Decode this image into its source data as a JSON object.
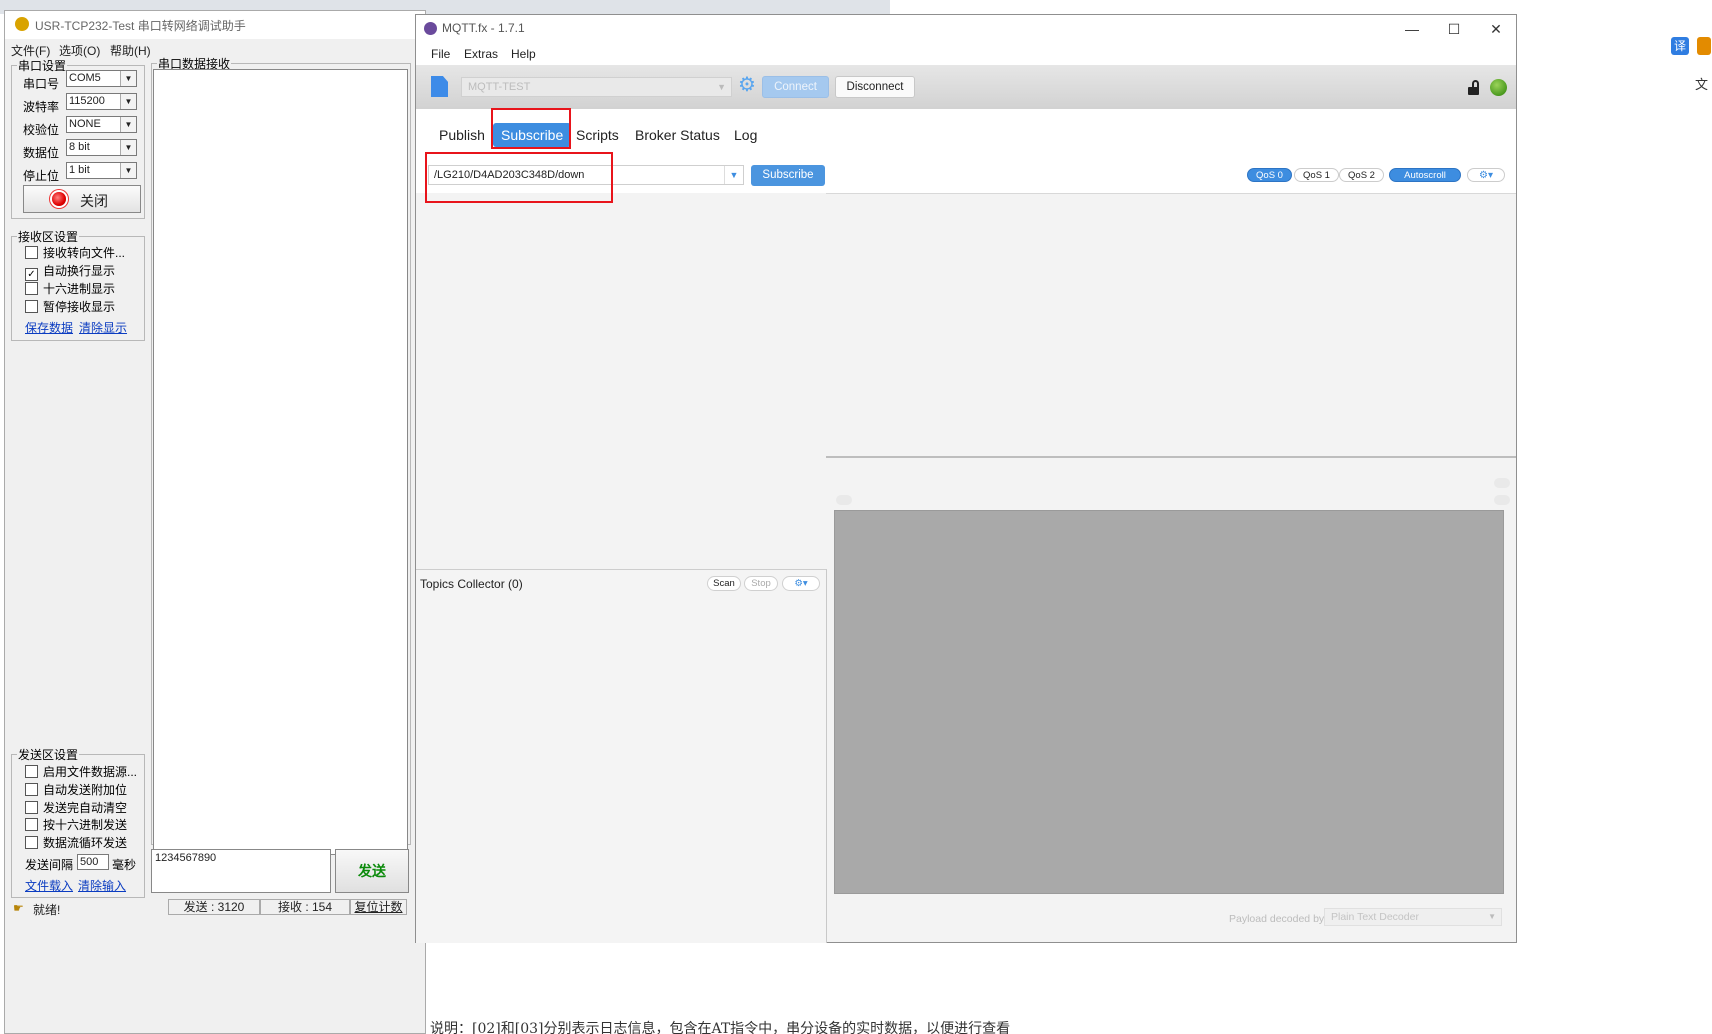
{
  "usr": {
    "title": "USR-TCP232-Test 串口转网络调试助手",
    "menu": [
      "文件(F)",
      "选项(O)",
      "帮助(H)"
    ],
    "serial_settings": {
      "legend": "串口设置",
      "rows": [
        {
          "label": "串口号",
          "value": "COM5"
        },
        {
          "label": "波特率",
          "value": "115200"
        },
        {
          "label": "校验位",
          "value": "NONE"
        },
        {
          "label": "数据位",
          "value": "8 bit"
        },
        {
          "label": "停止位",
          "value": "1 bit"
        }
      ],
      "close_button": "关闭"
    },
    "receive_settings": {
      "legend": "接收区设置",
      "options": [
        {
          "label": "接收转向文件...",
          "checked": false
        },
        {
          "label": "自动换行显示",
          "checked": true
        },
        {
          "label": "十六进制显示",
          "checked": false
        },
        {
          "label": "暂停接收显示",
          "checked": false
        }
      ],
      "link_save": "保存数据",
      "link_clear": "清除显示"
    },
    "receive_panel_title": "串口数据接收",
    "send_settings": {
      "legend": "发送区设置",
      "options": [
        {
          "label": "启用文件数据源...",
          "checked": false
        },
        {
          "label": "自动发送附加位",
          "checked": false
        },
        {
          "label": "发送完自动清空",
          "checked": false
        },
        {
          "label": "按十六进制发送",
          "checked": false
        },
        {
          "label": "数据流循环发送",
          "checked": false
        }
      ],
      "interval_label": "发送间隔",
      "interval_value": "500",
      "interval_unit": "毫秒",
      "link_load": "文件载入",
      "link_clear": "清除输入"
    },
    "send_text": "1234567890",
    "send_button": "发送",
    "status": {
      "ready": "就绪!",
      "sent": "发送 : 3120",
      "received": "接收 : 154",
      "reset": "复位计数"
    }
  },
  "mqtt": {
    "title": "MQTT.fx - 1.7.1",
    "window_controls": [
      "—",
      "☐",
      "✕"
    ],
    "menu": [
      "File",
      "Extras",
      "Help"
    ],
    "toolbar": {
      "profile": "MQTT-TEST",
      "connect": "Connect",
      "disconnect": "Disconnect"
    },
    "tabs": [
      "Publish",
      "Subscribe",
      "Scripts",
      "Broker Status",
      "Log"
    ],
    "active_tab": "Subscribe",
    "subscribe": {
      "topic": "/LG210/D4AD203C348D/down",
      "button": "Subscribe",
      "qos": [
        "QoS 0",
        "QoS 1",
        "QoS 2"
      ],
      "qos_selected": "QoS 0",
      "autoscroll": "Autoscroll"
    },
    "topics_collector": {
      "title": "Topics Collector (0)",
      "scan": "Scan",
      "stop": "Stop"
    },
    "payload": {
      "decoded_by_label": "Payload decoded by",
      "decoder": "Plain Text Decoder"
    }
  },
  "background": {
    "right_edge_text": "文",
    "document_snippet": "说明：[02]和[03]分别表示日志信息，包含在AT指令中，串分设备的实时数据，以便进行查看"
  },
  "colors": {
    "accent_blue": "#3d8de0",
    "highlight_red": "#e8141b",
    "status_green": "#4b9a1f",
    "send_green": "#0a8a0a"
  }
}
